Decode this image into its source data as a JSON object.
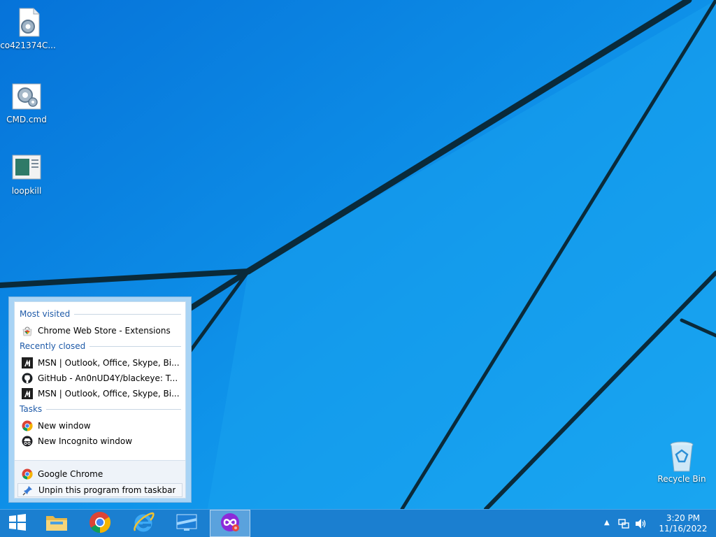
{
  "desktop": {
    "icons": [
      {
        "label": "co421374C...",
        "icon": "settings-file-icon"
      },
      {
        "label": "CMD.cmd",
        "icon": "cmd-gear-icon"
      },
      {
        "label": "loopkill",
        "icon": "batch-window-icon"
      },
      {
        "label": "Recycle Bin",
        "icon": "recycle-bin-icon"
      }
    ]
  },
  "jumplist": {
    "most_visited_header": "Most visited",
    "most_visited": [
      {
        "label": "Chrome Web Store - Extensions",
        "icon": "webstore-icon"
      }
    ],
    "recently_closed_header": "Recently closed",
    "recently_closed": [
      {
        "label": "MSN | Outlook, Office, Skype, Bi...",
        "icon": "msn-icon"
      },
      {
        "label": "GitHub - An0nUD4Y/blackeye: T...",
        "icon": "github-icon"
      },
      {
        "label": "MSN | Outlook, Office, Skype, Bi...",
        "icon": "msn-icon"
      }
    ],
    "tasks_header": "Tasks",
    "tasks": [
      {
        "label": "New window",
        "icon": "chrome-icon"
      },
      {
        "label": "New Incognito window",
        "icon": "incognito-icon"
      }
    ],
    "app_label": "Google Chrome",
    "unpin_label": "Unpin this program from taskbar"
  },
  "taskbar": {
    "buttons": [
      "start-icon",
      "file-explorer-icon",
      "chrome-icon",
      "internet-explorer-icon",
      "desktop-app-icon",
      "phishing-app-icon"
    ],
    "time": "3:20 PM",
    "date": "11/16/2022"
  },
  "colors": {
    "wallpaper": "#0a86e6",
    "taskbar": "#1b7fd0",
    "header_text": "#1e5aa8"
  }
}
